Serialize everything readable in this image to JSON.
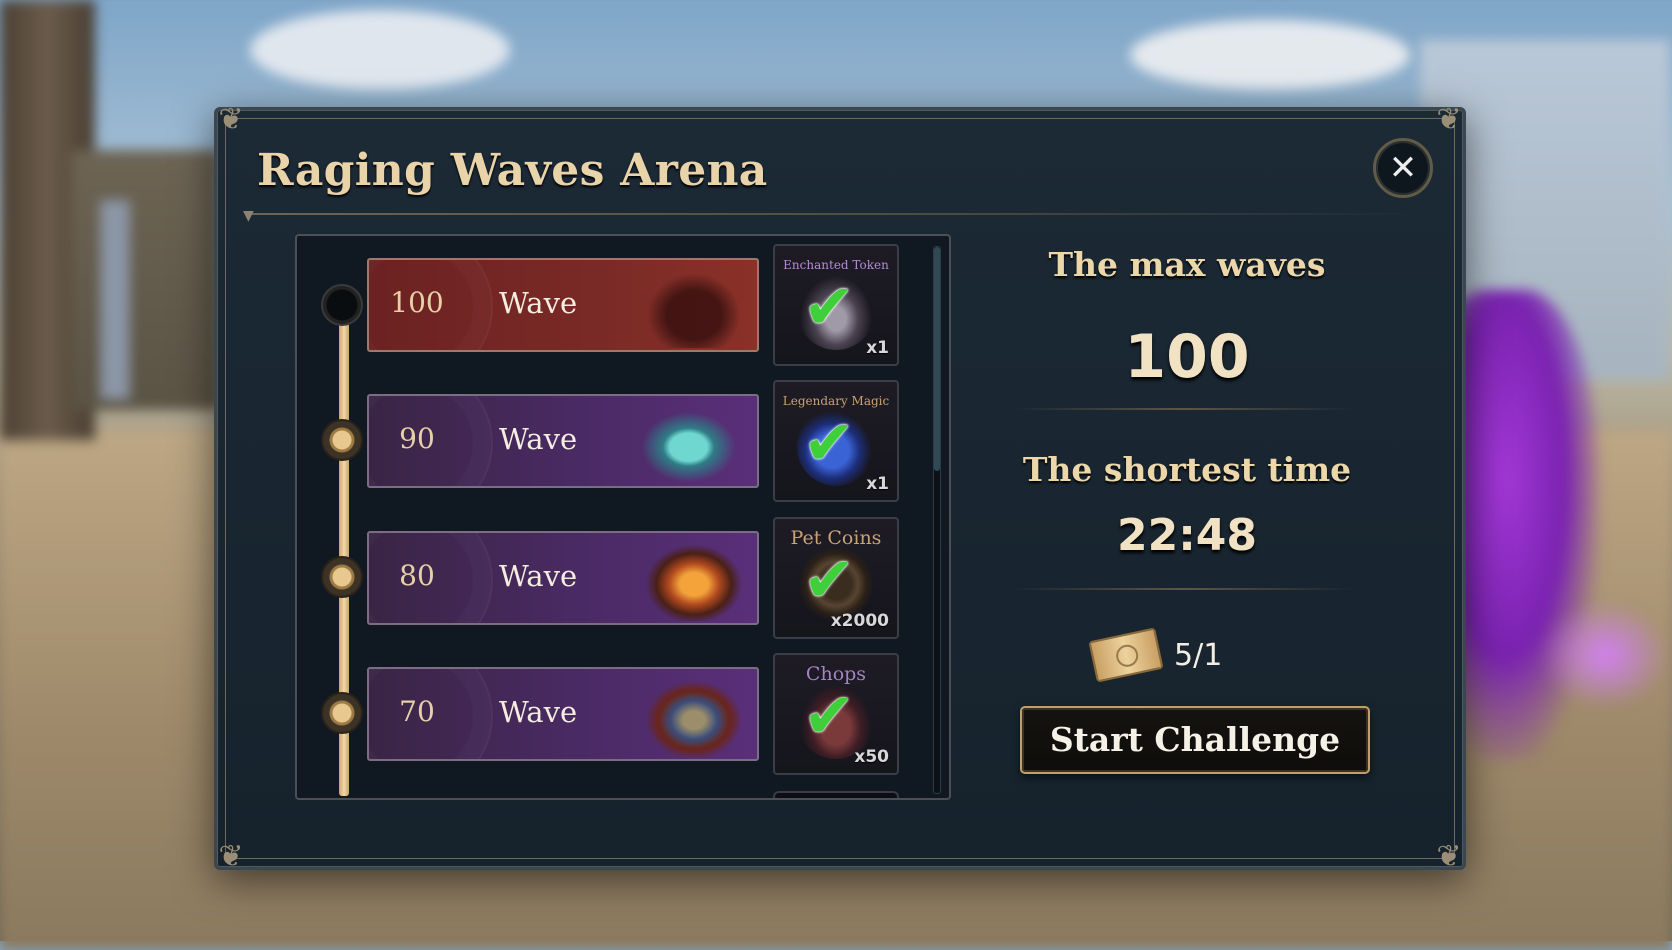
{
  "window": {
    "title": "Raging Waves Arena",
    "close_icon": "close-icon"
  },
  "waves": [
    {
      "number": "100",
      "label": "Wave",
      "reward_name": "Enchanted Token",
      "reward_qty": "x1",
      "claimed": true,
      "reward_icon": "enchanted-token-icon"
    },
    {
      "number": "90",
      "label": "Wave",
      "reward_name": "Legendary Magic",
      "reward_qty": "x1",
      "claimed": true,
      "reward_icon": "legendary-magic-icon"
    },
    {
      "number": "80",
      "label": "Wave",
      "reward_name": "Pet Coins",
      "reward_qty": "x2000",
      "claimed": true,
      "reward_icon": "pet-coins-icon"
    },
    {
      "number": "70",
      "label": "Wave",
      "reward_name": "Chops",
      "reward_qty": "x50",
      "claimed": true,
      "reward_icon": "chops-icon"
    }
  ],
  "stats": {
    "max_waves_label": "The max waves",
    "max_waves_value": "100",
    "shortest_time_label": "The shortest time",
    "shortest_time_value": "22:48"
  },
  "ticket": {
    "icon": "ticket-icon",
    "count": "5/1"
  },
  "start_button": {
    "label": "Start Challenge"
  },
  "check_glyph": "✔",
  "corner_glyph": "❦",
  "close_glyph": "✕",
  "colors": {
    "title": "#e9d3a8",
    "panel": "#1c2a36",
    "check": "#3fcf3a",
    "wave_row": "#4a2a64",
    "wave_row_top": "#7a2a26"
  }
}
